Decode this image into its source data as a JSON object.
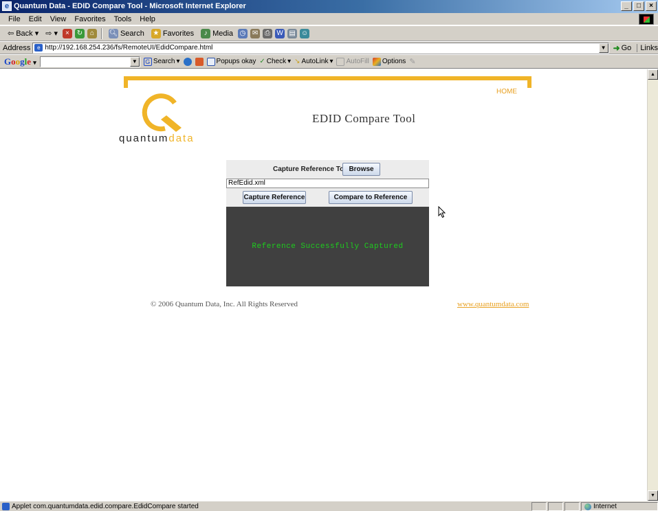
{
  "window": {
    "title": "Quantum Data - EDID Compare Tool - Microsoft Internet Explorer",
    "buttons": [
      "_",
      "□",
      "×"
    ]
  },
  "menu": [
    "File",
    "Edit",
    "View",
    "Favorites",
    "Tools",
    "Help"
  ],
  "toolbar": {
    "back": "Back",
    "search": "Search",
    "favorites": "Favorites",
    "media": "Media"
  },
  "address": {
    "label": "Address",
    "url": "http://192.168.254.236/fs/RemoteUI/EdidCompare.html",
    "go": "Go",
    "links": "Links"
  },
  "google_toolbar": {
    "search": "Search",
    "popups": "Popups okay",
    "check": "Check",
    "autolink": "AutoLink",
    "autofill": "AutoFill",
    "options": "Options"
  },
  "page": {
    "home_link": "HOME",
    "logo_text_main": "quantum",
    "logo_text_accent": "data",
    "title": "EDID Compare Tool",
    "copyright": "© 2006 Quantum Data, Inc. All Rights Reserved",
    "site_link": "www.quantumdata.com",
    "brand_color": "#f0b428"
  },
  "applet": {
    "capture_label": "Capture Reference To:",
    "browse_label": "Browse",
    "file_value": "RefEdid.xml",
    "capture_button": "Capture Reference",
    "compare_button": "Compare to Reference",
    "console_message": "Reference Successfully Captured",
    "console_color": "#1ecc1e"
  },
  "status": {
    "text": "Applet com.quantumdata.edid.compare.EdidCompare started",
    "zone": "Internet"
  }
}
